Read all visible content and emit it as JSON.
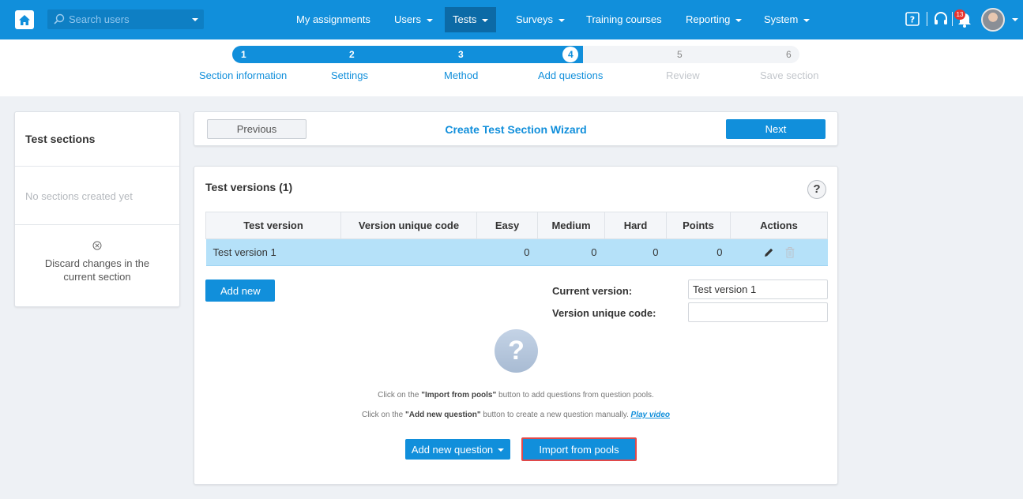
{
  "topbar": {
    "search_placeholder": "Search users",
    "nav": [
      {
        "label": "My assignments",
        "has_caret": false
      },
      {
        "label": "Users",
        "has_caret": true
      },
      {
        "label": "Tests",
        "has_caret": true,
        "active": true
      },
      {
        "label": "Surveys",
        "has_caret": true
      },
      {
        "label": "Training courses",
        "has_caret": false
      },
      {
        "label": "Reporting",
        "has_caret": true
      },
      {
        "label": "System",
        "has_caret": true
      }
    ],
    "notification_count": "13",
    "icons": [
      "home-icon",
      "search-icon",
      "help-book-icon",
      "headset-icon",
      "bell-icon",
      "avatar"
    ],
    "brand_color": "#118fdb"
  },
  "stepper": {
    "steps": [
      {
        "num": "1",
        "label": "Section information",
        "state": "done"
      },
      {
        "num": "2",
        "label": "Settings",
        "state": "done"
      },
      {
        "num": "3",
        "label": "Method",
        "state": "done"
      },
      {
        "num": "4",
        "label": "Add questions",
        "state": "current"
      },
      {
        "num": "5",
        "label": "Review",
        "state": "todo"
      },
      {
        "num": "6",
        "label": "Save section",
        "state": "todo"
      }
    ]
  },
  "sidebar": {
    "title": "Test sections",
    "empty_text": "No sections created yet",
    "discard_text": "Discard changes in the current section"
  },
  "wizard": {
    "previous_label": "Previous",
    "title": "Create Test Section Wizard",
    "next_label": "Next"
  },
  "versions": {
    "title": "Test versions (1)",
    "columns": [
      "Test version",
      "Version unique code",
      "Easy",
      "Medium",
      "Hard",
      "Points",
      "Actions"
    ],
    "rows": [
      {
        "name": "Test version 1",
        "code": "",
        "easy": "0",
        "medium": "0",
        "hard": "0",
        "points": "0"
      }
    ],
    "add_new_label": "Add new",
    "current_version_label": "Current version:",
    "current_version_value": "Test version 1",
    "unique_code_label": "Version unique code:",
    "unique_code_value": ""
  },
  "questions": {
    "hint1_pre": "Click on the ",
    "hint1_bold": "\"Import from pools\"",
    "hint1_post": " button to add questions from question pools.",
    "hint2_pre": "Click on the ",
    "hint2_bold": "\"Add new question\"",
    "hint2_post": " button to create a new question manually. ",
    "play_video": "Play video",
    "add_question_label": "Add new question",
    "import_label": "Import from pools",
    "highlight_color": "#e0494a"
  }
}
